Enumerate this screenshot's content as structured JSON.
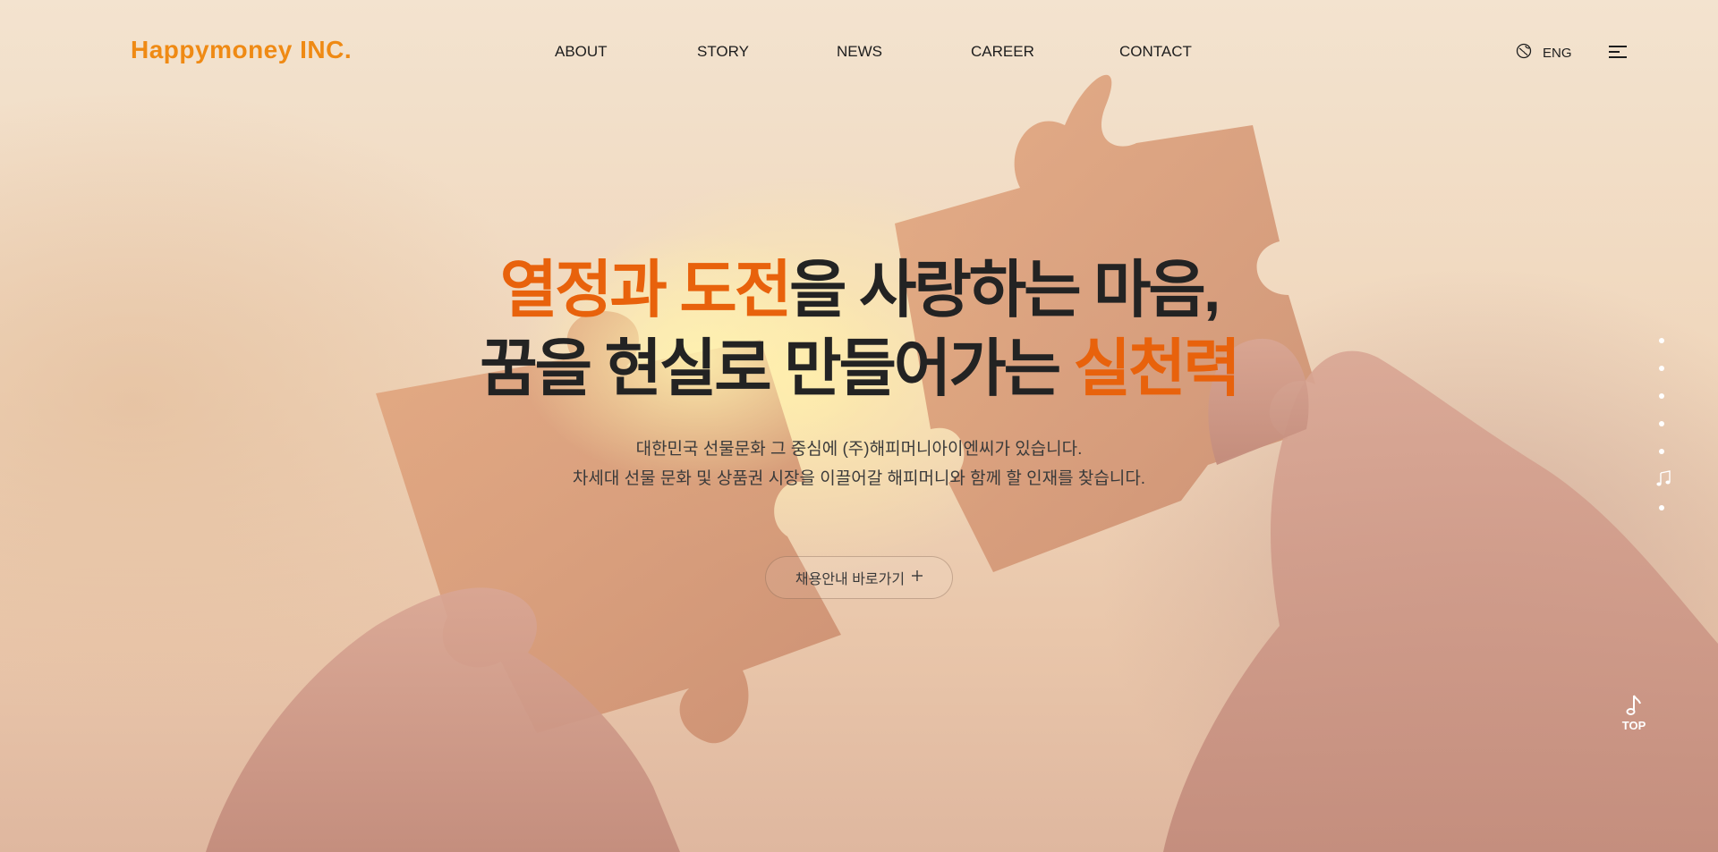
{
  "header": {
    "logo": "Happymoney INC.",
    "nav": [
      "ABOUT",
      "STORY",
      "NEWS",
      "CAREER",
      "CONTACT"
    ],
    "lang_label": "ENG",
    "lang_icon": "globe-icon",
    "menu_icon": "hamburger-menu-icon"
  },
  "hero": {
    "line1_accent": "열정과 도전",
    "line1_rest": "을 사랑하는 마음,",
    "line2_rest": "꿈을 현실로 만들어가는 ",
    "line2_accent": "실천력",
    "sub1": "대한민국 선물문화 그 중심에 (주)해피머니아이엔씨가 있습니다.",
    "sub2": "차세대 선물 문화 및 상품권 시장을 이끌어갈 해피머니와 함께 할 인재를 찾습니다.",
    "cta_label": "채용안내 바로가기",
    "cta_icon": "plus-icon"
  },
  "side": {
    "pager_icon": "music-note-icon",
    "top_label": "TOP",
    "top_icon": "music-note-icon"
  },
  "colors": {
    "brand": "#ef8a14",
    "accent": "#e8620c",
    "text": "#232323"
  }
}
